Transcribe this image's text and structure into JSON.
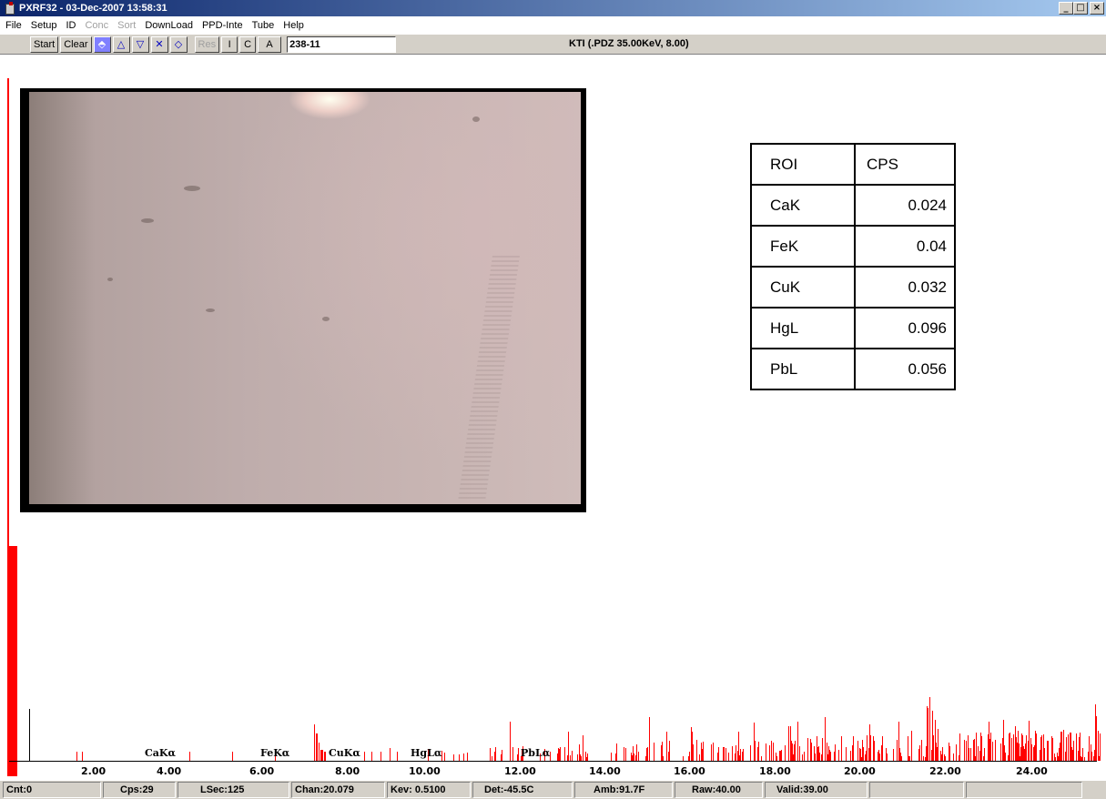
{
  "window": {
    "title": "PXRF32 - 03-Dec-2007 13:58:31",
    "minimize": "_",
    "maximize": "□",
    "close": "×"
  },
  "menu": [
    {
      "label": "File",
      "enabled": true
    },
    {
      "label": "Setup",
      "enabled": true
    },
    {
      "label": "ID",
      "enabled": true
    },
    {
      "label": "Conc",
      "enabled": false
    },
    {
      "label": "Sort",
      "enabled": false
    },
    {
      "label": "DownLoad",
      "enabled": true
    },
    {
      "label": "PPD-Inte",
      "enabled": true
    },
    {
      "label": "Tube",
      "enabled": true
    },
    {
      "label": "Help",
      "enabled": true
    }
  ],
  "toolbar": {
    "start": "Start",
    "clear": "Clear",
    "nav_icons": [
      "⬘",
      "△",
      "▽",
      "✕",
      "◇"
    ],
    "res": "Res",
    "i": "I",
    "c": "C",
    "a": "A",
    "sample_id": "238-11",
    "kti": "KTI  (.PDZ 35.00KeV, 8.00)"
  },
  "roi_table": {
    "headers": [
      "ROI",
      "CPS"
    ],
    "rows": [
      [
        "CaK",
        "0.024"
      ],
      [
        "FeK",
        "0.04"
      ],
      [
        "CuK",
        "0.032"
      ],
      [
        "HgL",
        "0.096"
      ],
      [
        "PbL",
        "0.056"
      ]
    ]
  },
  "spectrum": {
    "peak_labels": [
      "CaKα",
      "FeKα",
      "CuKα",
      "HgLα",
      "PbLα"
    ],
    "axis_ticks": [
      "2.00",
      "4.00",
      "6.00",
      "8.00",
      "10.00",
      "12.00",
      "14.00",
      "16.00",
      "18.00",
      "20.00",
      "22.00",
      "24.00"
    ],
    "color": "#ff0000"
  },
  "status": [
    "Cnt:0",
    "Cps:29",
    "LSec:125",
    "Chan:20.079",
    "Kev: 0.5100",
    "Det:-45.5C",
    "Amb:91.7F",
    "Raw:40.00",
    "Valid:39.00",
    "",
    ""
  ]
}
